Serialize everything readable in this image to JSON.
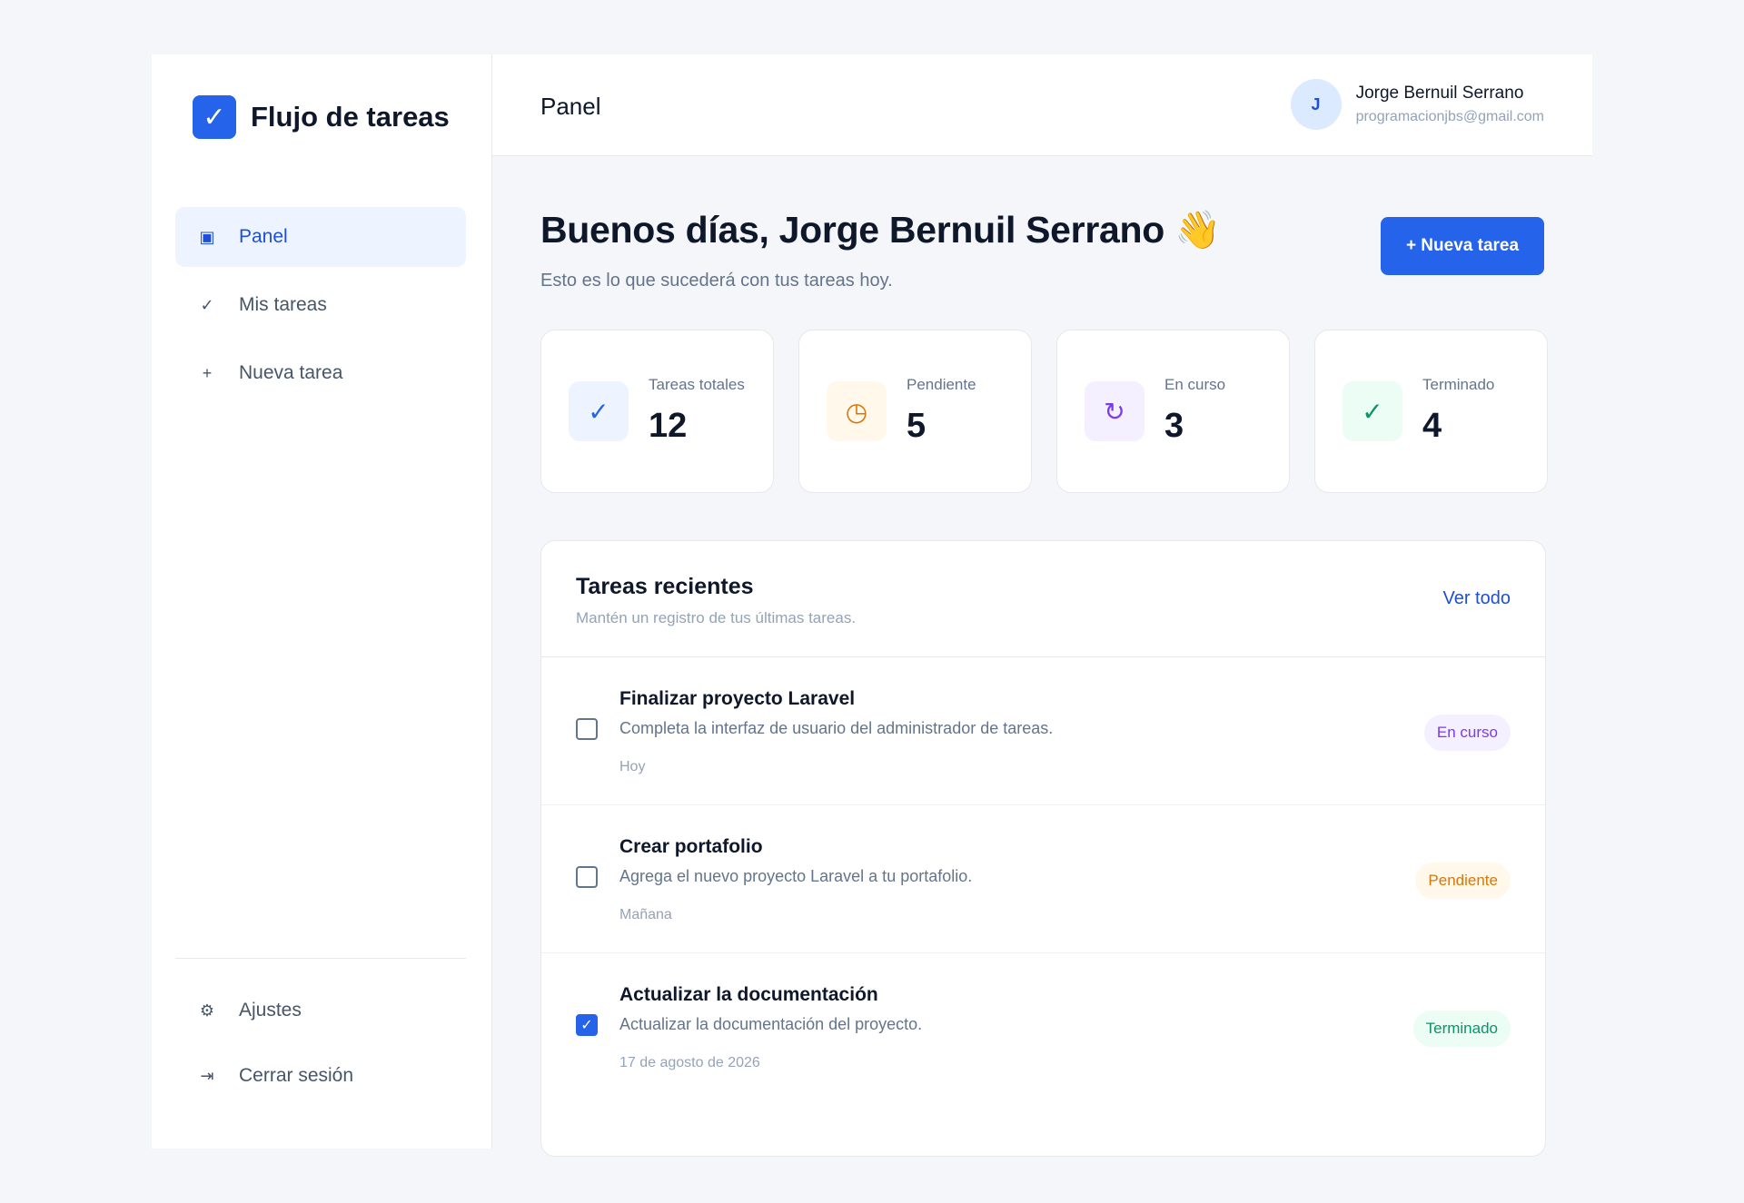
{
  "brand": {
    "name": "Flujo de tareas",
    "logo_icon": "check-icon"
  },
  "sidebar": {
    "items": [
      {
        "label": "Panel",
        "icon": "dashboard-icon",
        "glyph": "▣",
        "active": true
      },
      {
        "label": "Mis tareas",
        "icon": "check-icon",
        "glyph": "✓",
        "active": false
      },
      {
        "label": "Nueva tarea",
        "icon": "plus-icon",
        "glyph": "+",
        "active": false
      }
    ],
    "bottom": [
      {
        "label": "Ajustes",
        "icon": "gear-icon",
        "glyph": "⚙"
      },
      {
        "label": "Cerrar sesión",
        "icon": "logout-icon",
        "glyph": "⇥"
      }
    ]
  },
  "topbar": {
    "title": "Panel",
    "user": {
      "initial": "J",
      "name": "Jorge Bernuil Serrano",
      "email": "programacionjbs@gmail.com"
    }
  },
  "greeting": {
    "title": "Buenos días, Jorge Bernuil Serrano 👋",
    "subtitle": "Esto es lo que sucederá con tus tareas hoy."
  },
  "actions": {
    "new_task_label": "+ Nueva tarea"
  },
  "stats": [
    {
      "label": "Tareas totales",
      "value": "12",
      "icon": "check-icon",
      "glyph": "✓",
      "color": "#2563eb",
      "bg": "#eef4ff"
    },
    {
      "label": "Pendiente",
      "value": "5",
      "icon": "clock-icon",
      "glyph": "◷",
      "color": "#d97706",
      "bg": "#fff8eb"
    },
    {
      "label": "En curso",
      "value": "3",
      "icon": "refresh-icon",
      "glyph": "↻",
      "color": "#7c3aed",
      "bg": "#f4f0ff"
    },
    {
      "label": "Terminado",
      "value": "4",
      "icon": "check-icon",
      "glyph": "✓",
      "color": "#059669",
      "bg": "#ecfdf5"
    }
  ],
  "recent": {
    "title": "Tareas recientes",
    "subtitle": "Mantén un registro de tus últimas tareas.",
    "view_all": "Ver todo",
    "tasks": [
      {
        "title": "Finalizar proyecto Laravel",
        "description": "Completa la interfaz de usuario del administrador de tareas.",
        "date": "Hoy",
        "status": "En curso",
        "checked": false,
        "badge_color": "#7c3aed",
        "badge_bg": "#f4f0ff"
      },
      {
        "title": "Crear portafolio",
        "description": "Agrega el nuevo proyecto Laravel a tu portafolio.",
        "date": "Mañana",
        "status": "Pendiente",
        "checked": false,
        "badge_color": "#d97706",
        "badge_bg": "#fff8eb"
      },
      {
        "title": "Actualizar la documentación",
        "description": "Actualizar la documentación del proyecto.",
        "date": "17 de agosto de 2026",
        "status": "Terminado",
        "checked": true,
        "badge_color": "#059669",
        "badge_bg": "#ecfdf5"
      }
    ]
  }
}
